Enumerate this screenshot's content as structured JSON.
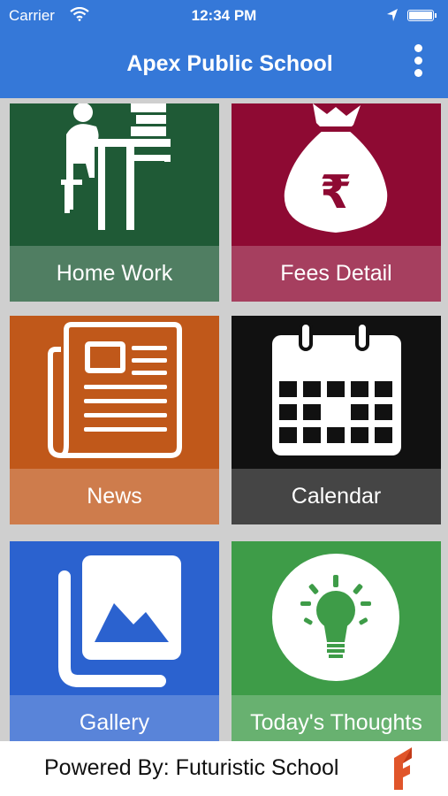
{
  "status_bar": {
    "carrier": "Carrier",
    "time": "12:34 PM"
  },
  "header": {
    "title": "Apex Public School"
  },
  "tiles": [
    {
      "label": "Home Work",
      "icon": "homework-desk-icon",
      "color": "#1f5a36"
    },
    {
      "label": "Fees Detail",
      "icon": "rupee-bag-icon",
      "color": "#8e0a33"
    },
    {
      "label": "News",
      "icon": "newspaper-icon",
      "color": "#c0581a"
    },
    {
      "label": "Calendar",
      "icon": "calendar-icon",
      "color": "#111111"
    },
    {
      "label": "Gallery",
      "icon": "gallery-icon",
      "color": "#2b62cf"
    },
    {
      "label": "Today's Thoughts",
      "icon": "lightbulb-icon",
      "color": "#3e9c48"
    }
  ],
  "footer": {
    "text": "Powered By: Futuristic School",
    "logo": "futuristic-school-logo"
  }
}
